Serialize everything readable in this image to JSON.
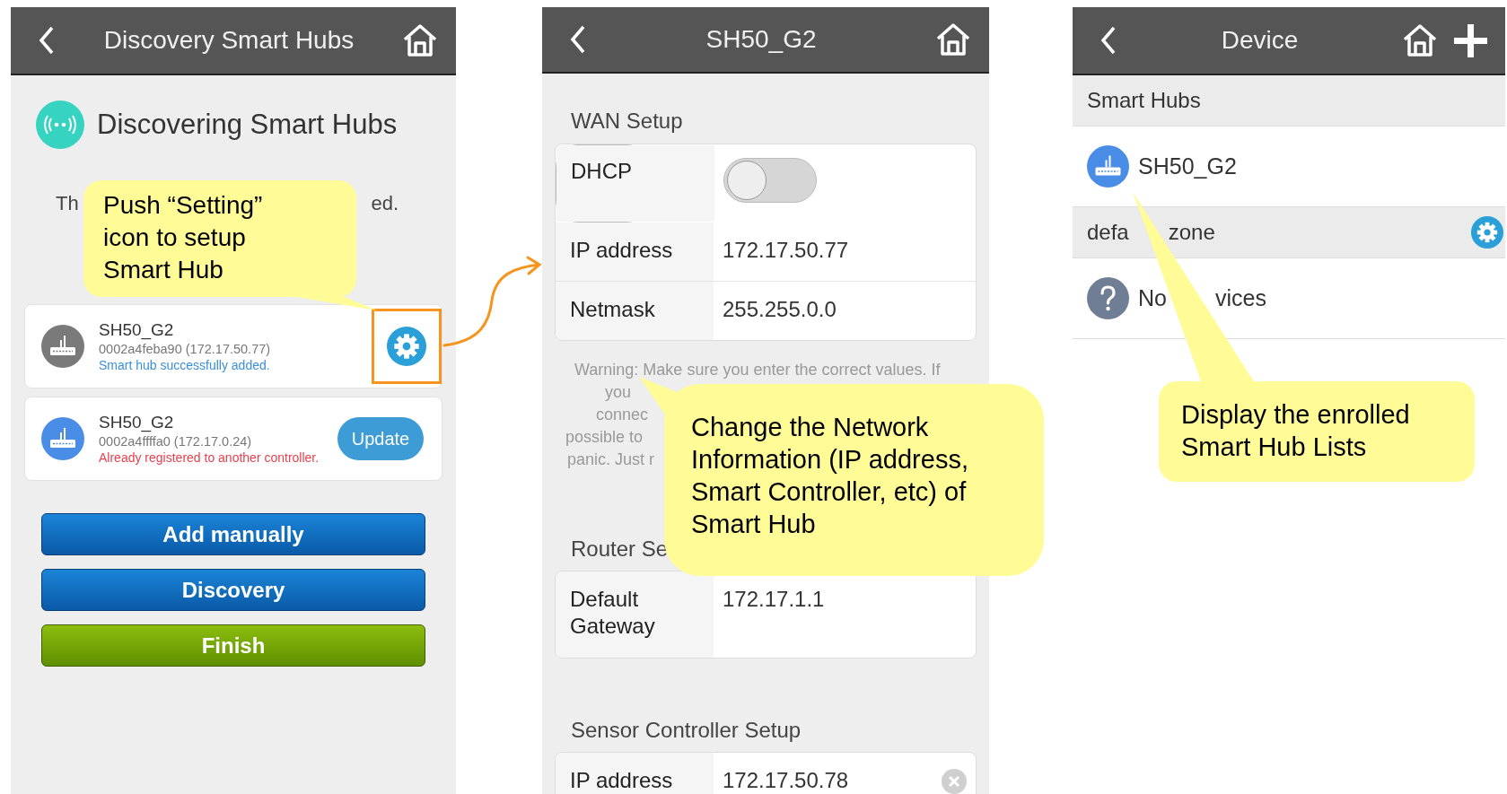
{
  "discovery_screen": {
    "header": {
      "title": "Discovery Smart Hubs",
      "buttons": [
        {
          "kind": "home"
        }
      ]
    },
    "heading": "Discovering Smart Hubs",
    "status_parts": [
      "Th",
      "ed."
    ],
    "hubs": [
      {
        "name": "SH50_G2",
        "detail": "0002a4feba90 (172.17.50.77)",
        "message": "Smart hub successfully added.",
        "kind": "added",
        "action": {
          "kind": "settings",
          "highlighted": true
        }
      },
      {
        "name": "SH50_G2",
        "detail": "0002a4ffffa0 (172.17.0.24)",
        "message": "Already registered to another controller.",
        "kind": "conflict",
        "action": {
          "kind": "update",
          "label": "Update",
          "highlighted": false
        }
      }
    ],
    "buttons": [
      {
        "label": "Add manually",
        "kind": "primary"
      },
      {
        "label": "Discovery",
        "kind": "primary"
      },
      {
        "label": "Finish",
        "kind": "confirm"
      }
    ],
    "callout": {
      "text": "Push “Setting” icon to setup Smart Hub"
    }
  },
  "hub_setup_screen": {
    "header": {
      "title": "SH50_G2",
      "buttons": [
        {
          "kind": "home"
        }
      ]
    },
    "sections": [
      {
        "title": "WAN Setup",
        "rows": [
          {
            "label": "DHCP",
            "kind": "toggle",
            "on": false
          },
          {
            "label": "IP address",
            "kind": "text",
            "value": "172.17.50.77"
          },
          {
            "label": "Netmask",
            "kind": "text",
            "value": "255.255.0.0"
          }
        ],
        "note_lines": [
          "Warning: Make sure you enter the correct values. If",
          "you",
          "connec",
          "possible to",
          "panic. Just r"
        ]
      },
      {
        "title": "Router Se",
        "rows": [
          {
            "label": "Default Gateway",
            "kind": "text",
            "value": "172.17.1.1"
          }
        ]
      },
      {
        "title": "Sensor Controller Setup",
        "rows": [
          {
            "label": "IP address",
            "kind": "clearable",
            "value": "172.17.50.78"
          }
        ]
      }
    ],
    "callout": {
      "text": "Change the Network Information (IP address, Smart Controller, etc) of Smart Hub"
    }
  },
  "device_screen": {
    "header": {
      "title": "Device",
      "buttons": [
        {
          "kind": "home"
        },
        {
          "kind": "add"
        }
      ]
    },
    "groups": [
      {
        "title_parts": [
          "Smart Hubs"
        ],
        "settings": false,
        "items": [
          {
            "label_parts": [
              "SH50_G2"
            ],
            "kind": "hub"
          }
        ]
      },
      {
        "title_parts": [
          "defa",
          "zone"
        ],
        "settings": true,
        "items": [
          {
            "label_parts": [
              "No",
              "vices"
            ],
            "kind": "unknown"
          }
        ]
      }
    ],
    "callout": {
      "text": "Display the enrolled Smart Hub Lists"
    }
  }
}
